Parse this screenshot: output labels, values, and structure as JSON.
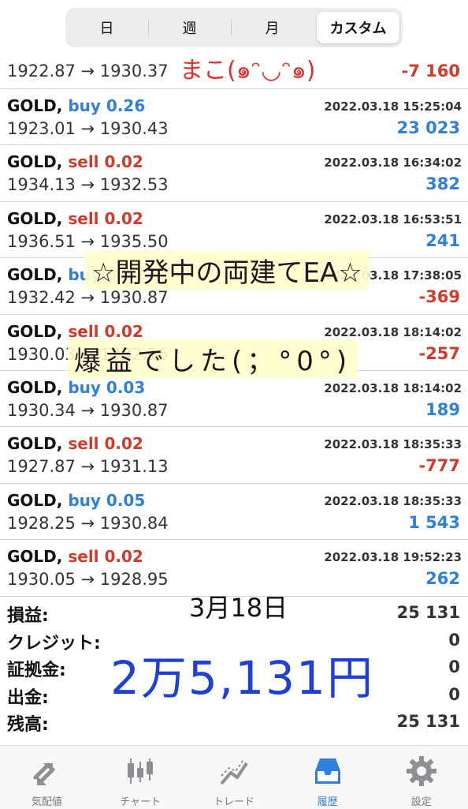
{
  "segments": {
    "day": "日",
    "week": "週",
    "month": "月",
    "custom": "カスタム",
    "active": "custom"
  },
  "partial_trade": {
    "prices": "1922.87 → 1930.37",
    "profit": "-7 160"
  },
  "trades": [
    {
      "symbol": "GOLD,",
      "side": "buy",
      "volume": "0.26",
      "time": "2022.03.18 15:25:04",
      "prices": "1923.01 → 1930.43",
      "profit": "23 023",
      "profit_sign": "pos"
    },
    {
      "symbol": "GOLD,",
      "side": "sell",
      "volume": "0.02",
      "time": "2022.03.18 16:34:02",
      "prices": "1934.13 → 1932.53",
      "profit": "382",
      "profit_sign": "pos"
    },
    {
      "symbol": "GOLD,",
      "side": "sell",
      "volume": "0.02",
      "time": "2022.03.18 16:53:51",
      "prices": "1936.51 → 1935.50",
      "profit": "241",
      "profit_sign": "pos"
    },
    {
      "symbol": "GOLD,",
      "side": "buy",
      "volume": "0.02",
      "time": "2022.03.18 17:38:05",
      "prices": "1932.42 → 1930.87",
      "profit": "-369",
      "profit_sign": "neg"
    },
    {
      "symbol": "GOLD,",
      "side": "sell",
      "volume": "0.02",
      "time": "2022.03.18 18:14:02",
      "prices": "1930.03 → 1932.16",
      "profit": "-257",
      "profit_sign": "neg"
    },
    {
      "symbol": "GOLD,",
      "side": "buy",
      "volume": "0.03",
      "time": "2022.03.18 18:14:02",
      "prices": "1930.34 → 1930.87",
      "profit": "189",
      "profit_sign": "pos"
    },
    {
      "symbol": "GOLD,",
      "side": "sell",
      "volume": "0.02",
      "time": "2022.03.18 18:35:33",
      "prices": "1927.87 → 1931.13",
      "profit": "-777",
      "profit_sign": "neg"
    },
    {
      "symbol": "GOLD,",
      "side": "buy",
      "volume": "0.05",
      "time": "2022.03.18 18:35:33",
      "prices": "1928.25 → 1930.84",
      "profit": "1 543",
      "profit_sign": "pos"
    },
    {
      "symbol": "GOLD,",
      "side": "sell",
      "volume": "0.02",
      "time": "2022.03.18 19:52:23",
      "prices": "1930.05 → 1928.95",
      "profit": "262",
      "profit_sign": "pos"
    }
  ],
  "summary": [
    {
      "label": "損益:",
      "value": "25 131"
    },
    {
      "label": "クレジット:",
      "value": "0"
    },
    {
      "label": "証拠金:",
      "value": "0"
    },
    {
      "label": "出金:",
      "value": "0"
    },
    {
      "label": "残高:",
      "value": "25 131"
    }
  ],
  "tabbar": [
    {
      "label": "気配値",
      "icon": "quotes-icon"
    },
    {
      "label": "チャート",
      "icon": "chart-icon"
    },
    {
      "label": "トレード",
      "icon": "trade-icon"
    },
    {
      "label": "履歴",
      "icon": "history-icon"
    },
    {
      "label": "設定",
      "icon": "settings-icon"
    }
  ],
  "active_tab": "履歴",
  "overlay_notes": {
    "top": "まこ(๑ᵔ◡ᵔ๑)",
    "dev": "☆開発中の両建てEA☆",
    "profit": "爆益でした(；°0°)",
    "date": "3月18日",
    "yen": "2万5,131円"
  },
  "colors": {
    "sell": "#d23a2a",
    "buy": "#2f7fdc",
    "accent": "#2f7fdc",
    "handwriting_blue": "#1e3fd8",
    "handwriting_red": "#e33030"
  }
}
